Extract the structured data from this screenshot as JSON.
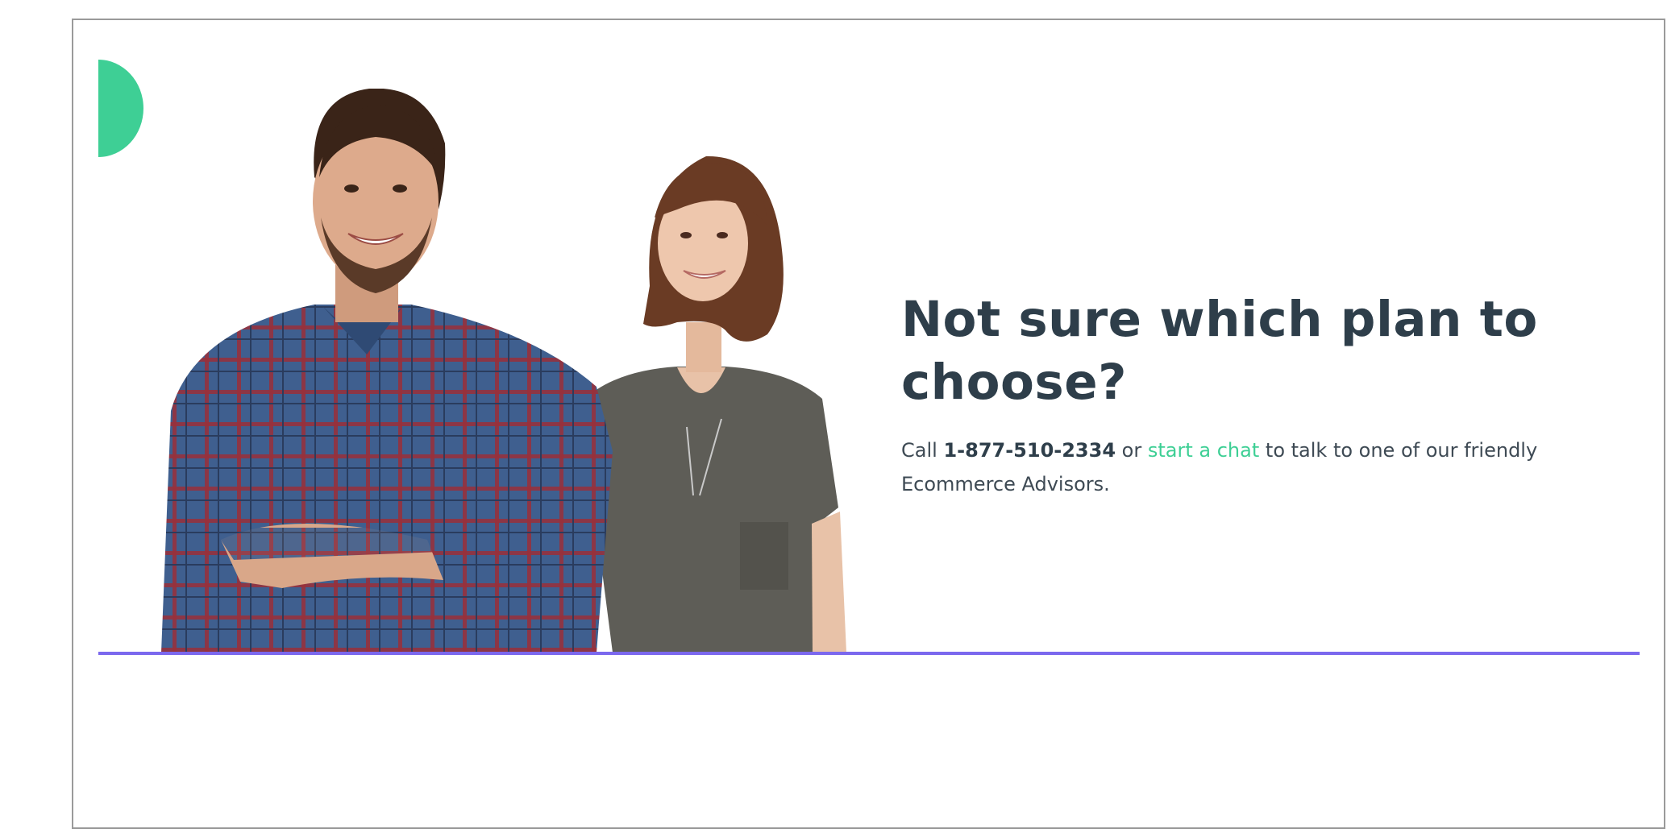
{
  "colors": {
    "brand_green": "#3ecf95",
    "accent_purple": "#7b68ee",
    "heading": "#2e3e4a",
    "body": "#3e4a54",
    "plaid_blue": "#3f5f8f",
    "plaid_red": "#9a2f3a",
    "tshirt_gray": "#5e5d57"
  },
  "hero": {
    "image": {
      "subjects": "man-in-plaid-shirt-and-woman-in-gray-tshirt"
    },
    "headline": "Not sure which plan to choose?",
    "body": {
      "prefix": "Call",
      "phone": "1-877-510-2334",
      "connector": "or",
      "chat_link": "start a chat",
      "suffix": "to talk to one of our friendly Ecommerce Advisors."
    }
  }
}
